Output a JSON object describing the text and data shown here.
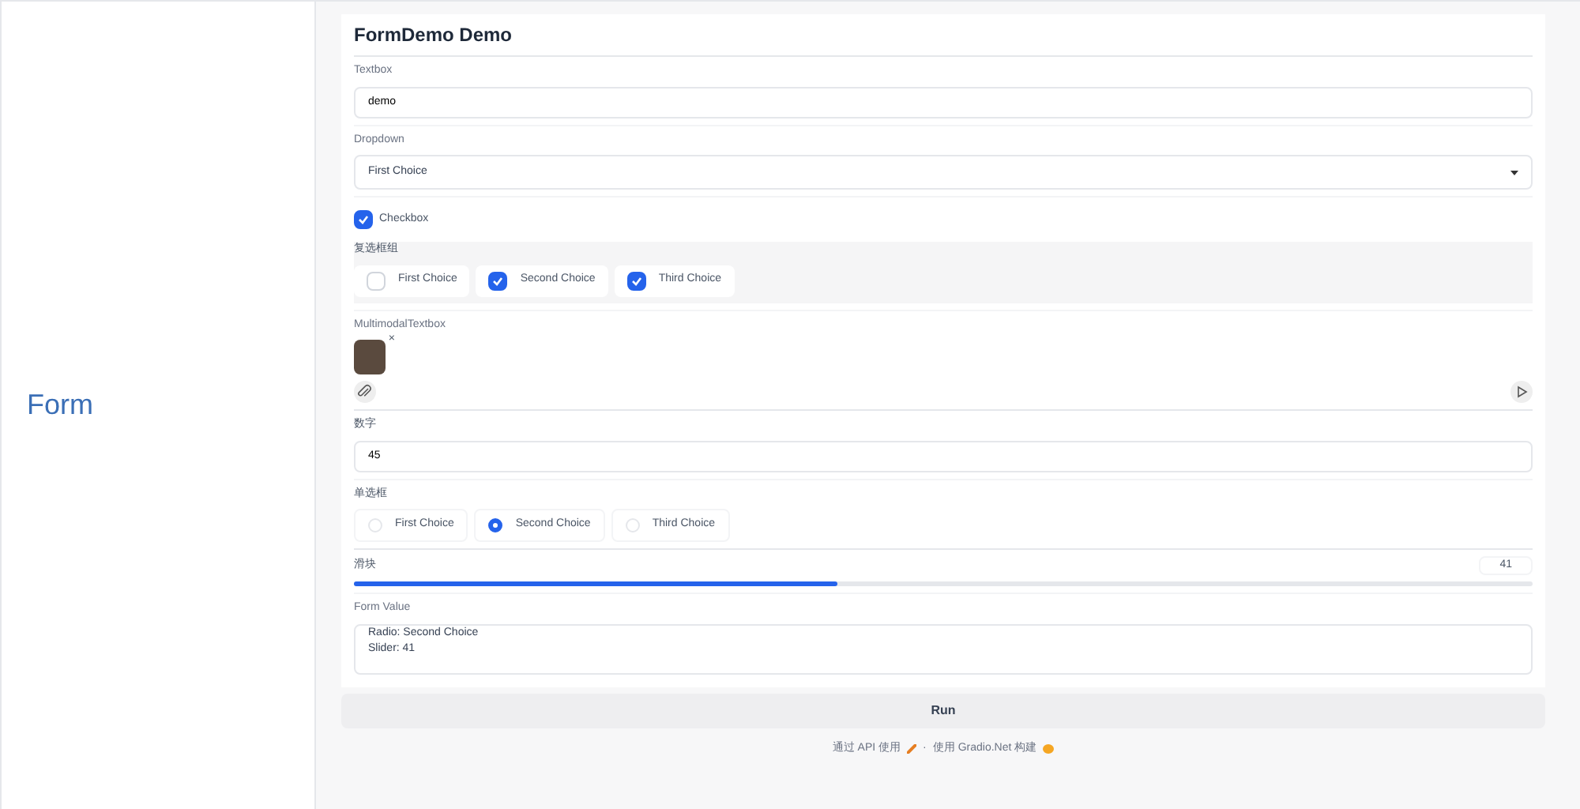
{
  "row_label": "Form",
  "title": "FormDemo Demo",
  "textbox": {
    "label": "Textbox",
    "value": "demo"
  },
  "dropdown": {
    "label": "Dropdown",
    "value": "First Choice"
  },
  "checkbox": {
    "label": "Checkbox",
    "checked": true
  },
  "checkbox_group": {
    "label": "复选框组",
    "options": [
      {
        "label": "First Choice",
        "checked": false
      },
      {
        "label": "Second Choice",
        "checked": true
      },
      {
        "label": "Third Choice",
        "checked": true
      }
    ]
  },
  "multimodal": {
    "label": "MultimodalTextbox",
    "remove_icon": "×"
  },
  "number": {
    "label": "数字",
    "value": "45"
  },
  "radio": {
    "label": "单选框",
    "options": [
      {
        "label": "First Choice",
        "selected": false
      },
      {
        "label": "Second Choice",
        "selected": true
      },
      {
        "label": "Third Choice",
        "selected": false
      }
    ]
  },
  "slider": {
    "label": "滑块",
    "value": "41",
    "level": 0.41
  },
  "form_value": {
    "label": "Form Value",
    "lines": [
      "Radio: Second Choice",
      "Slider: 41"
    ]
  },
  "run_button": "Run",
  "footer": {
    "api_link": "通过 API 使用",
    "separator": "·",
    "built_with": "使用 Gradio.Net 构建"
  }
}
